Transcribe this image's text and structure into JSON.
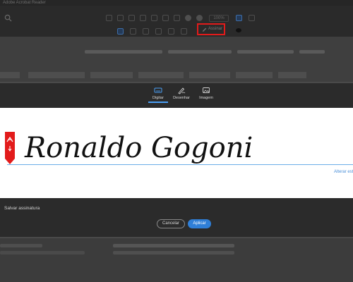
{
  "app": {
    "title": "Adobe Acrobat Reader"
  },
  "toolbar": {
    "zoom": "100%",
    "sign_tool_label": "Assinar",
    "sign_tool_highlight": "#e21b1b"
  },
  "dialog": {
    "tabs": [
      {
        "label": "Digitar",
        "icon": "keyboard-icon",
        "active": true
      },
      {
        "label": "Desenhar",
        "icon": "pen-draw-icon",
        "active": false
      },
      {
        "label": "Imagem",
        "icon": "image-icon",
        "active": false
      }
    ],
    "signature_text": "Ronaldo Gogoni",
    "change_style_link": "Alterar estilo",
    "save_signature_label": "Salvar assinatura",
    "cancel_label": "Cancelar",
    "apply_label": "Aplicar"
  },
  "colors": {
    "accent": "#2f7fd8",
    "adobe_red": "#e21b1b",
    "dialog_bg": "#2b2b2b"
  }
}
